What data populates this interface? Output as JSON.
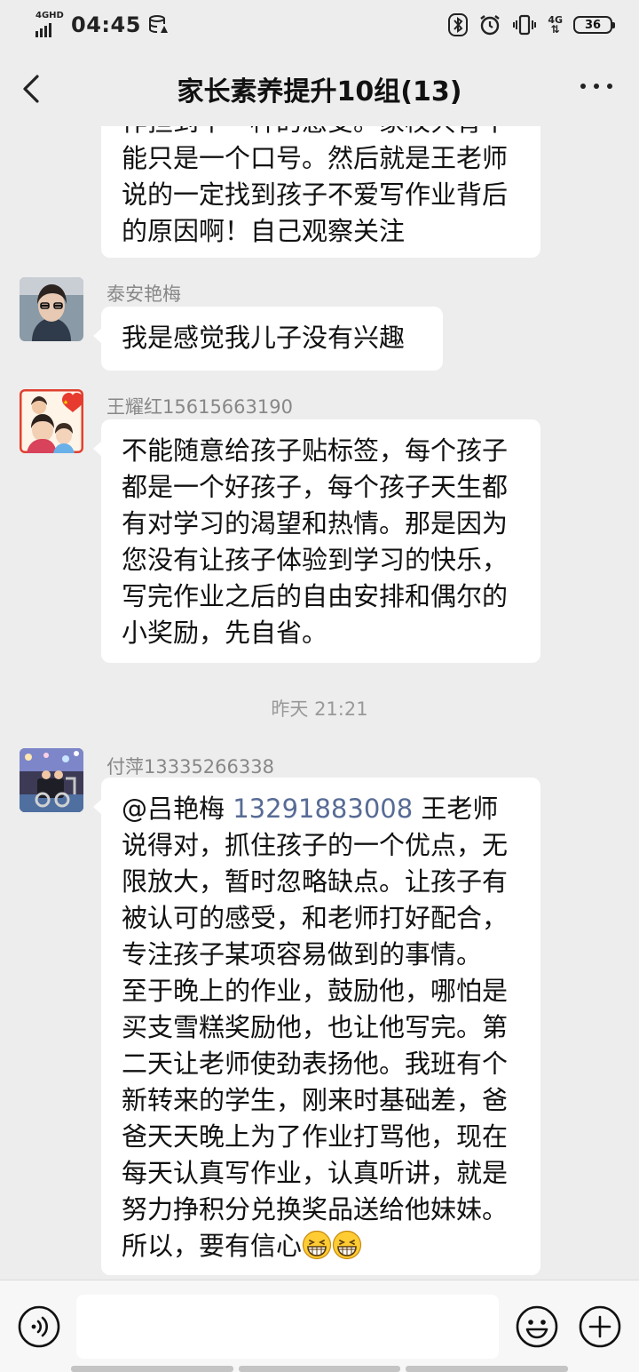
{
  "status_bar": {
    "network_type": "4GHD",
    "time": "04:45",
    "mobile_data": "4G",
    "battery": "36"
  },
  "header": {
    "title": "家长素养提升10组(13)"
  },
  "messages": [
    {
      "lines": [
        "作担到中一种的感受。家校共育不",
        "能只是一个口号。然后就是王老师",
        "说的一定找到孩子不爱写作业背后",
        "的原因啊！自己观察关注"
      ]
    },
    {
      "sender": "泰安艳梅",
      "lines": [
        "我是感觉我儿子没有兴趣"
      ]
    },
    {
      "sender": "王耀红15615663190",
      "lines": [
        "不能随意给孩子贴标签，每个孩子",
        "都是一个好孩子，每个孩子天生都",
        "有对学习的渴望和热情。那是因为",
        "您没有让孩子体验到学习的快乐，",
        "写完作业之后的自由安排和偶尔的",
        "小奖励，先自省。"
      ]
    },
    {
      "sender": "付萍13335266338",
      "mention_name": "@吕艳梅 ",
      "mention_number": "13291883008",
      "first_line_rest": " 王老师",
      "lines": [
        "说得对，抓住孩子的一个优点，无",
        "限放大，暂时忽略缺点。让孩子有",
        "被认可的感受，和老师打好配合，",
        "专注孩子某项容易做到的事情。",
        "至于晚上的作业，鼓励他，哪怕是",
        "买支雪糕奖励他，也让他写完。第",
        "二天让老师使劲表扬他。我班有个",
        "新转来的学生，刚来时基础差，爸",
        "爸天天晚上为了作业打骂他，现在",
        "每天认真写作业，认真听讲，就是",
        "努力挣积分兑换奖品送给他妹妹。"
      ],
      "last_line": "所以，要有信心",
      "emojis": [
        "grinning-emoji",
        "grinning-emoji"
      ]
    }
  ],
  "timestamp": "昨天 21:21",
  "input": {
    "placeholder": "",
    "value": ""
  },
  "colors": {
    "background": "#ededed",
    "bubble": "#ffffff",
    "mention": "#576b95",
    "sender": "#888888"
  }
}
